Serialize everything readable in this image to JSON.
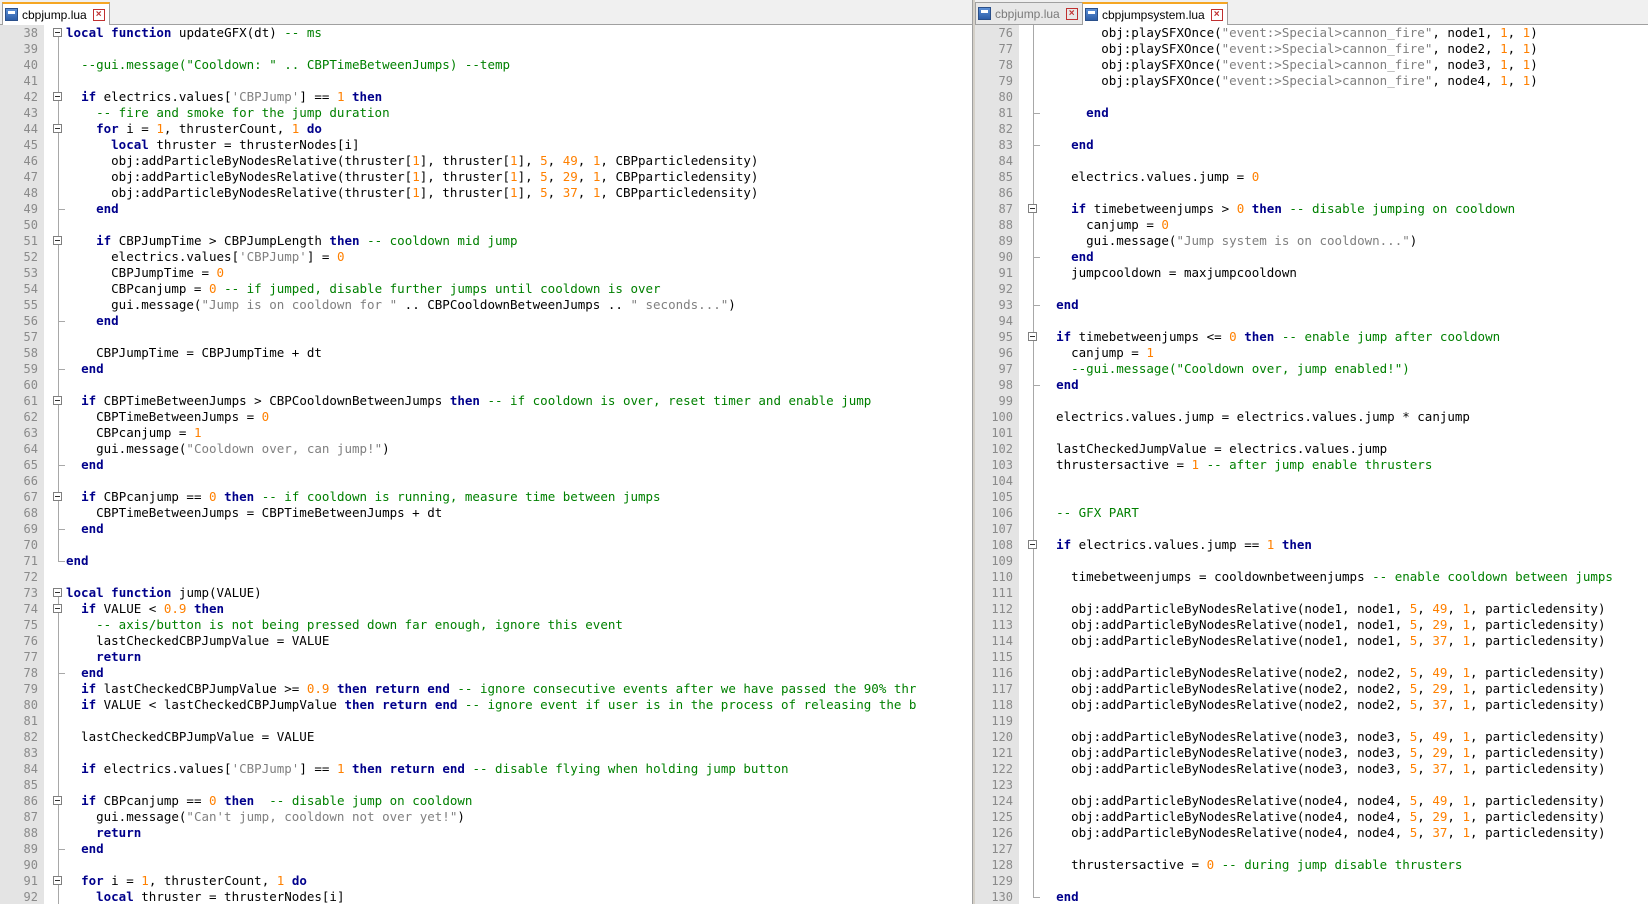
{
  "left_pane": {
    "tabs": [
      {
        "label": "cbpjump.lua",
        "active": true
      }
    ],
    "lines": [
      {
        "n": "38",
        "fold": "box",
        "t": "[[kw:local]] [[kw:function]] updateGFX(dt) [[cm:-- ms]]"
      },
      {
        "n": "39",
        "fold": "bar",
        "t": ""
      },
      {
        "n": "40",
        "fold": "bar",
        "t": "  [[cm:--gui.message(\"Cooldown: \" .. CBPTimeBetweenJumps) --temp]]"
      },
      {
        "n": "41",
        "fold": "bar",
        "t": ""
      },
      {
        "n": "42",
        "fold": "box",
        "t": "  [[kw:if]] electrics.values[[[st:'CBPJump']]] == [[nm:1]] [[kw:then]]"
      },
      {
        "n": "43",
        "fold": "bar",
        "t": "    [[cm:-- fire and smoke for the jump duration]]"
      },
      {
        "n": "44",
        "fold": "box",
        "t": "    [[kw:for]] i = [[nm:1]], thrusterCount, [[nm:1]] [[kw:do]]"
      },
      {
        "n": "45",
        "fold": "bar",
        "t": "      [[kw:local]] thruster = thrusterNodes[i]"
      },
      {
        "n": "46",
        "fold": "bar",
        "t": "      obj:addParticleByNodesRelative(thruster[[[nm:1]]], thruster[[[nm:1]]], [[nm:5]], [[nm:49]], [[nm:1]], CBPparticledensity)"
      },
      {
        "n": "47",
        "fold": "bar",
        "t": "      obj:addParticleByNodesRelative(thruster[[[nm:1]]], thruster[[[nm:1]]], [[nm:5]], [[nm:29]], [[nm:1]], CBPparticledensity)"
      },
      {
        "n": "48",
        "fold": "bar",
        "t": "      obj:addParticleByNodesRelative(thruster[[[nm:1]]], thruster[[[nm:1]]], [[nm:5]], [[nm:37]], [[nm:1]], CBPparticledensity)"
      },
      {
        "n": "49",
        "fold": "end",
        "t": "    [[kw:end]]"
      },
      {
        "n": "50",
        "fold": "bar",
        "t": ""
      },
      {
        "n": "51",
        "fold": "box",
        "t": "    [[kw:if]] CBPJumpTime > CBPJumpLength [[kw:then]] [[cm:-- cooldown mid jump]]"
      },
      {
        "n": "52",
        "fold": "bar",
        "t": "      electrics.values[[[st:'CBPJump']]] = [[nm:0]]"
      },
      {
        "n": "53",
        "fold": "bar",
        "t": "      CBPJumpTime = [[nm:0]]"
      },
      {
        "n": "54",
        "fold": "bar",
        "t": "      CBPcanjump = [[nm:0]] [[cm:-- if jumped, disable further jumps until cooldown is over]]"
      },
      {
        "n": "55",
        "fold": "bar",
        "t": "      gui.message([[st:\"Jump is on cooldown for \"]] .. CBPCooldownBetweenJumps .. [[st:\" seconds...\"]])"
      },
      {
        "n": "56",
        "fold": "end",
        "t": "    [[kw:end]]"
      },
      {
        "n": "57",
        "fold": "bar",
        "t": ""
      },
      {
        "n": "58",
        "fold": "bar",
        "t": "    CBPJumpTime = CBPJumpTime + dt"
      },
      {
        "n": "59",
        "fold": "end",
        "t": "  [[kw:end]]"
      },
      {
        "n": "60",
        "fold": "bar",
        "t": ""
      },
      {
        "n": "61",
        "fold": "box",
        "t": "  [[kw:if]] CBPTimeBetweenJumps > CBPCooldownBetweenJumps [[kw:then]] [[cm:-- if cooldown is over, reset timer and enable jump]]"
      },
      {
        "n": "62",
        "fold": "bar",
        "t": "    CBPTimeBetweenJumps = [[nm:0]]"
      },
      {
        "n": "63",
        "fold": "bar",
        "t": "    CBPcanjump = [[nm:1]]"
      },
      {
        "n": "64",
        "fold": "bar",
        "t": "    gui.message([[st:\"Cooldown over, can jump!\"]])"
      },
      {
        "n": "65",
        "fold": "end",
        "t": "  [[kw:end]]"
      },
      {
        "n": "66",
        "fold": "bar",
        "t": ""
      },
      {
        "n": "67",
        "fold": "box",
        "t": "  [[kw:if]] CBPcanjump == [[nm:0]] [[kw:then]] [[cm:-- if cooldown is running, measure time between jumps]]"
      },
      {
        "n": "68",
        "fold": "bar",
        "t": "    CBPTimeBetweenJumps = CBPTimeBetweenJumps + dt"
      },
      {
        "n": "69",
        "fold": "end",
        "t": "  [[kw:end]]"
      },
      {
        "n": "70",
        "fold": "bar",
        "t": ""
      },
      {
        "n": "71",
        "fold": "end",
        "t": "[[kw:end]]"
      },
      {
        "n": "72",
        "fold": "none",
        "t": ""
      },
      {
        "n": "73",
        "fold": "box",
        "t": "[[kw:local]] [[kw:function]] jump(VALUE)"
      },
      {
        "n": "74",
        "fold": "box",
        "t": "  [[kw:if]] VALUE < [[nm:0.9]] [[kw:then]]"
      },
      {
        "n": "75",
        "fold": "bar",
        "t": "    [[cm:-- axis/button is not being pressed down far enough, ignore this event]]"
      },
      {
        "n": "76",
        "fold": "bar",
        "t": "    lastCheckedCBPJumpValue = VALUE"
      },
      {
        "n": "77",
        "fold": "bar",
        "t": "    [[kw:return]]"
      },
      {
        "n": "78",
        "fold": "end",
        "t": "  [[kw:end]]"
      },
      {
        "n": "79",
        "fold": "bar",
        "t": "  [[kw:if]] lastCheckedCBPJumpValue >= [[nm:0.9]] [[kw:then]] [[kw:return]] [[kw:end]] [[cm:-- ignore consecutive events after we have passed the 90% thr]]"
      },
      {
        "n": "80",
        "fold": "bar",
        "t": "  [[kw:if]] VALUE < lastCheckedCBPJumpValue [[kw:then]] [[kw:return]] [[kw:end]] [[cm:-- ignore event if user is in the process of releasing the b]]"
      },
      {
        "n": "81",
        "fold": "bar",
        "t": ""
      },
      {
        "n": "82",
        "fold": "bar",
        "t": "  lastCheckedCBPJumpValue = VALUE"
      },
      {
        "n": "83",
        "fold": "bar",
        "t": ""
      },
      {
        "n": "84",
        "fold": "bar",
        "t": "  [[kw:if]] electrics.values[[[st:'CBPJump']]] == [[nm:1]] [[kw:then]] [[kw:return]] [[kw:end]] [[cm:-- disable flying when holding jump button]]"
      },
      {
        "n": "85",
        "fold": "bar",
        "t": ""
      },
      {
        "n": "86",
        "fold": "box",
        "t": "  [[kw:if]] CBPcanjump == [[nm:0]] [[kw:then]]  [[cm:-- disable jump on cooldown]]"
      },
      {
        "n": "87",
        "fold": "bar",
        "t": "    gui.message([[st:\"Can't jump, cooldown not over yet!\"]])"
      },
      {
        "n": "88",
        "fold": "bar",
        "t": "    [[kw:return]]"
      },
      {
        "n": "89",
        "fold": "end",
        "t": "  [[kw:end]]"
      },
      {
        "n": "90",
        "fold": "bar",
        "t": ""
      },
      {
        "n": "91",
        "fold": "box",
        "t": "  [[kw:for]] i = [[nm:1]], thrusterCount, [[nm:1]] [[kw:do]]"
      },
      {
        "n": "92",
        "fold": "bar",
        "t": "    [[kw:local]] thruster = thrusterNodes[i]"
      }
    ]
  },
  "right_pane": {
    "tabs": [
      {
        "label": "cbpjump.lua",
        "active": false
      },
      {
        "label": "cbpjumpsystem.lua",
        "active": true
      }
    ],
    "lines": [
      {
        "n": "76",
        "fold": "bar",
        "t": "        obj:playSFXOnce([[st:\"event:>Special>cannon_fire\"]], node1, [[nm:1]], [[nm:1]])"
      },
      {
        "n": "77",
        "fold": "bar",
        "t": "        obj:playSFXOnce([[st:\"event:>Special>cannon_fire\"]], node2, [[nm:1]], [[nm:1]])"
      },
      {
        "n": "78",
        "fold": "bar",
        "t": "        obj:playSFXOnce([[st:\"event:>Special>cannon_fire\"]], node3, [[nm:1]], [[nm:1]])"
      },
      {
        "n": "79",
        "fold": "bar",
        "t": "        obj:playSFXOnce([[st:\"event:>Special>cannon_fire\"]], node4, [[nm:1]], [[nm:1]])"
      },
      {
        "n": "80",
        "fold": "bar",
        "t": ""
      },
      {
        "n": "81",
        "fold": "end",
        "t": "      [[kw:end]]"
      },
      {
        "n": "82",
        "fold": "bar",
        "t": ""
      },
      {
        "n": "83",
        "fold": "end",
        "t": "    [[kw:end]]"
      },
      {
        "n": "84",
        "fold": "bar",
        "t": ""
      },
      {
        "n": "85",
        "fold": "bar",
        "t": "    electrics.values.jump = [[nm:0]]"
      },
      {
        "n": "86",
        "fold": "bar",
        "t": ""
      },
      {
        "n": "87",
        "fold": "box",
        "t": "    [[kw:if]] timebetweenjumps > [[nm:0]] [[kw:then]] [[cm:-- disable jumping on cooldown]]"
      },
      {
        "n": "88",
        "fold": "bar",
        "t": "      canjump = [[nm:0]]"
      },
      {
        "n": "89",
        "fold": "bar",
        "t": "      gui.message([[st:\"Jump system is on cooldown...\"]])"
      },
      {
        "n": "90",
        "fold": "end",
        "t": "    [[kw:end]]"
      },
      {
        "n": "91",
        "fold": "bar",
        "t": "    jumpcooldown = maxjumpcooldown"
      },
      {
        "n": "92",
        "fold": "bar",
        "t": ""
      },
      {
        "n": "93",
        "fold": "end",
        "t": "  [[kw:end]]"
      },
      {
        "n": "94",
        "fold": "bar",
        "t": ""
      },
      {
        "n": "95",
        "fold": "box",
        "t": "  [[kw:if]] timebetweenjumps <= [[nm:0]] [[kw:then]] [[cm:-- enable jump after cooldown]]"
      },
      {
        "n": "96",
        "fold": "bar",
        "t": "    canjump = [[nm:1]]"
      },
      {
        "n": "97",
        "fold": "bar",
        "t": "    [[cm:--gui.message(\"Cooldown over, jump enabled!\")]]"
      },
      {
        "n": "98",
        "fold": "end",
        "t": "  [[kw:end]]"
      },
      {
        "n": "99",
        "fold": "bar",
        "t": ""
      },
      {
        "n": "100",
        "fold": "bar",
        "t": "  electrics.values.jump = electrics.values.jump * canjump"
      },
      {
        "n": "101",
        "fold": "bar",
        "t": ""
      },
      {
        "n": "102",
        "fold": "bar",
        "t": "  lastCheckedJumpValue = electrics.values.jump"
      },
      {
        "n": "103",
        "fold": "bar",
        "t": "  thrustersactive = [[nm:1]] [[cm:-- after jump enable thrusters]]"
      },
      {
        "n": "104",
        "fold": "bar",
        "t": ""
      },
      {
        "n": "105",
        "fold": "bar",
        "t": ""
      },
      {
        "n": "106",
        "fold": "bar",
        "t": "  [[cm:-- GFX PART]]"
      },
      {
        "n": "107",
        "fold": "bar",
        "t": ""
      },
      {
        "n": "108",
        "fold": "box",
        "t": "  [[kw:if]] electrics.values.jump == [[nm:1]] [[kw:then]]"
      },
      {
        "n": "109",
        "fold": "bar",
        "t": ""
      },
      {
        "n": "110",
        "fold": "bar",
        "t": "    timebetweenjumps = cooldownbetweenjumps [[cm:-- enable cooldown between jumps]]"
      },
      {
        "n": "111",
        "fold": "bar",
        "t": ""
      },
      {
        "n": "112",
        "fold": "bar",
        "t": "    obj:addParticleByNodesRelative(node1, node1, [[nm:5]], [[nm:49]], [[nm:1]], particledensity)"
      },
      {
        "n": "113",
        "fold": "bar",
        "t": "    obj:addParticleByNodesRelative(node1, node1, [[nm:5]], [[nm:29]], [[nm:1]], particledensity)"
      },
      {
        "n": "114",
        "fold": "bar",
        "t": "    obj:addParticleByNodesRelative(node1, node1, [[nm:5]], [[nm:37]], [[nm:1]], particledensity)"
      },
      {
        "n": "115",
        "fold": "bar",
        "t": ""
      },
      {
        "n": "116",
        "fold": "bar",
        "t": "    obj:addParticleByNodesRelative(node2, node2, [[nm:5]], [[nm:49]], [[nm:1]], particledensity)"
      },
      {
        "n": "117",
        "fold": "bar",
        "t": "    obj:addParticleByNodesRelative(node2, node2, [[nm:5]], [[nm:29]], [[nm:1]], particledensity)"
      },
      {
        "n": "118",
        "fold": "bar",
        "t": "    obj:addParticleByNodesRelative(node2, node2, [[nm:5]], [[nm:37]], [[nm:1]], particledensity)"
      },
      {
        "n": "119",
        "fold": "bar",
        "t": ""
      },
      {
        "n": "120",
        "fold": "bar",
        "t": "    obj:addParticleByNodesRelative(node3, node3, [[nm:5]], [[nm:49]], [[nm:1]], particledensity)"
      },
      {
        "n": "121",
        "fold": "bar",
        "t": "    obj:addParticleByNodesRelative(node3, node3, [[nm:5]], [[nm:29]], [[nm:1]], particledensity)"
      },
      {
        "n": "122",
        "fold": "bar",
        "t": "    obj:addParticleByNodesRelative(node3, node3, [[nm:5]], [[nm:37]], [[nm:1]], particledensity)"
      },
      {
        "n": "123",
        "fold": "bar",
        "t": ""
      },
      {
        "n": "124",
        "fold": "bar",
        "t": "    obj:addParticleByNodesRelative(node4, node4, [[nm:5]], [[nm:49]], [[nm:1]], particledensity)"
      },
      {
        "n": "125",
        "fold": "bar",
        "t": "    obj:addParticleByNodesRelative(node4, node4, [[nm:5]], [[nm:29]], [[nm:1]], particledensity)"
      },
      {
        "n": "126",
        "fold": "bar",
        "t": "    obj:addParticleByNodesRelative(node4, node4, [[nm:5]], [[nm:37]], [[nm:1]], particledensity)"
      },
      {
        "n": "127",
        "fold": "bar",
        "t": ""
      },
      {
        "n": "128",
        "fold": "bar",
        "t": "    thrustersactive = [[nm:0]] [[cm:-- during jump disable thrusters]]"
      },
      {
        "n": "129",
        "fold": "bar",
        "t": ""
      },
      {
        "n": "130",
        "fold": "end",
        "t": "  [[kw:end]]"
      }
    ]
  },
  "colors": {
    "keyword": "#00008b",
    "comment": "#008000",
    "string": "#808080",
    "number": "#ff8000",
    "active_tab_accent": "#f5a623"
  },
  "icons": {
    "file": "lua-file-icon",
    "close": "close-icon"
  }
}
